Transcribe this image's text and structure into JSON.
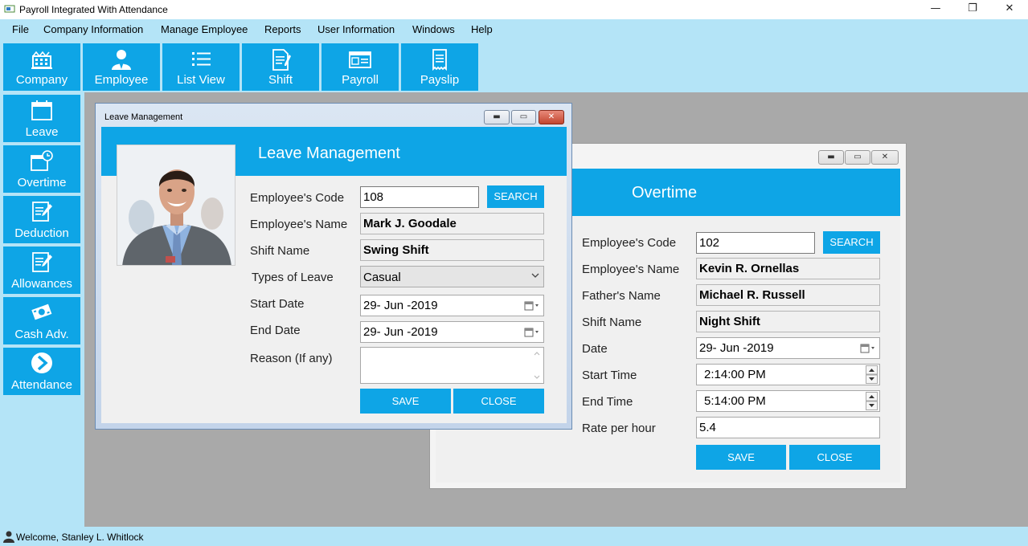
{
  "window": {
    "title": "Payroll Integrated With Attendance",
    "minimize_glyph": "—",
    "restore_glyph": "❐",
    "close_glyph": "✕"
  },
  "menu": [
    "File",
    "Company Information",
    "Manage Employee",
    "Reports",
    "User Information",
    "Windows",
    "Help"
  ],
  "toolbar": [
    {
      "label": "Company",
      "icon": "building-icon"
    },
    {
      "label": "Employee",
      "icon": "person-icon"
    },
    {
      "label": "List View",
      "icon": "list-icon"
    },
    {
      "label": "Shift",
      "icon": "document-pen-icon"
    },
    {
      "label": "Payroll",
      "icon": "payroll-card-icon"
    },
    {
      "label": "Payslip",
      "icon": "receipt-icon"
    }
  ],
  "sidebar": [
    {
      "label": "Leave",
      "icon": "calendar-icon"
    },
    {
      "label": "Overtime",
      "icon": "calendar-clock-icon"
    },
    {
      "label": "Deduction",
      "icon": "edit-document-icon"
    },
    {
      "label": "Allowances",
      "icon": "edit-document-icon"
    },
    {
      "label": "Cash Adv.",
      "icon": "money-icon"
    },
    {
      "label": "Attendance",
      "icon": "chevron-right-circle-icon"
    }
  ],
  "status": {
    "welcome": "Welcome, Stanley L. Whitlock"
  },
  "leave": {
    "caption": "Leave Management",
    "heading": "Leave Management",
    "labels": {
      "code": "Employee's Code",
      "name": "Employee's Name",
      "shift": "Shift Name",
      "type": "Types of Leave",
      "start": "Start Date",
      "end": "End Date",
      "reason": "Reason (If any)"
    },
    "values": {
      "code": "108",
      "name": "Mark J. Goodale",
      "shift": "Swing Shift",
      "type": "Casual",
      "start": "29- Jun -2019",
      "end": "29- Jun -2019",
      "reason": ""
    },
    "buttons": {
      "search": "SEARCH",
      "save": "SAVE",
      "close": "CLOSE"
    }
  },
  "overtime": {
    "heading": "Overtime",
    "labels": {
      "code": "Employee's Code",
      "name": "Employee's Name",
      "father": "Father's Name",
      "shift": "Shift Name",
      "date": "Date",
      "start": "Start Time",
      "end": "End Time",
      "rate": "Rate per hour"
    },
    "values": {
      "code": "102",
      "name": "Kevin R. Ornellas",
      "father": "Michael R. Russell",
      "shift": "Night Shift",
      "date": "29- Jun -2019",
      "start": "2:14:00 PM",
      "end": "5:14:00 PM",
      "rate": "5.4"
    },
    "buttons": {
      "search": "SEARCH",
      "save": "SAVE",
      "close": "CLOSE"
    }
  },
  "colors": {
    "accent": "#0ea5e6",
    "chrome": "#b4e4f7",
    "mdi": "#a9a9a9"
  }
}
